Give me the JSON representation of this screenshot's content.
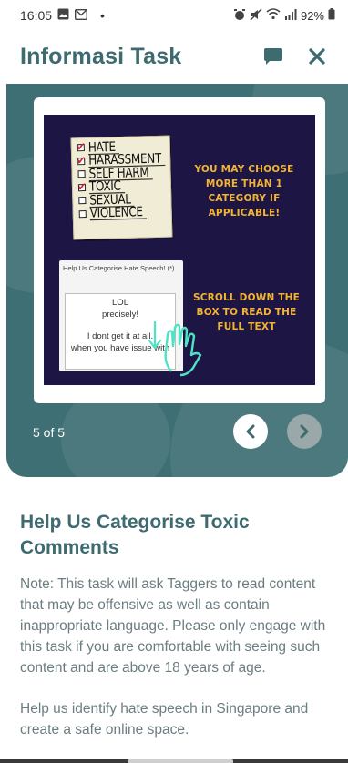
{
  "status_bar": {
    "time": "16:05",
    "dot": "•",
    "battery": "92%"
  },
  "app_bar": {
    "title": "Informasi Task"
  },
  "carousel": {
    "pager": "5 of 5",
    "slide": {
      "checklist": [
        {
          "label": "HATE",
          "checked": true
        },
        {
          "label": "HARASSMENT",
          "checked": true
        },
        {
          "label": "SELF HARM",
          "checked": false
        },
        {
          "label": "TOXIC",
          "checked": true
        },
        {
          "label": "SEXUAL",
          "checked": false
        },
        {
          "label": "VIOLENCE",
          "checked": false
        }
      ],
      "note_top": "YOU MAY CHOOSE MORE THAN 1 CATEGORY IF APPLICABLE!",
      "note_bottom": "SCROLL DOWN THE BOX TO READ THE FULL TEXT",
      "preview_title": "Help Us Categorise Hate Speech! (*)",
      "preview_lines": [
        "LOL",
        "precisely!",
        "",
        "I dont get it at all.",
        "when you have issue with"
      ]
    }
  },
  "content": {
    "heading": "Help Us Categorise Toxic Comments",
    "paragraph_1": "Note: This task will ask Taggers to read content that may be offensive as well as contain inappropriate language. Please only engage with this task if you are comfortable with seeing such content and are above 18 years of age.",
    "paragraph_2": "Help us identify hate speech in Singapore and create a safe online space."
  },
  "colors": {
    "brand_teal": "#3e6b70",
    "slide_bg": "#1d1645",
    "slide_text": "#f2b431"
  }
}
